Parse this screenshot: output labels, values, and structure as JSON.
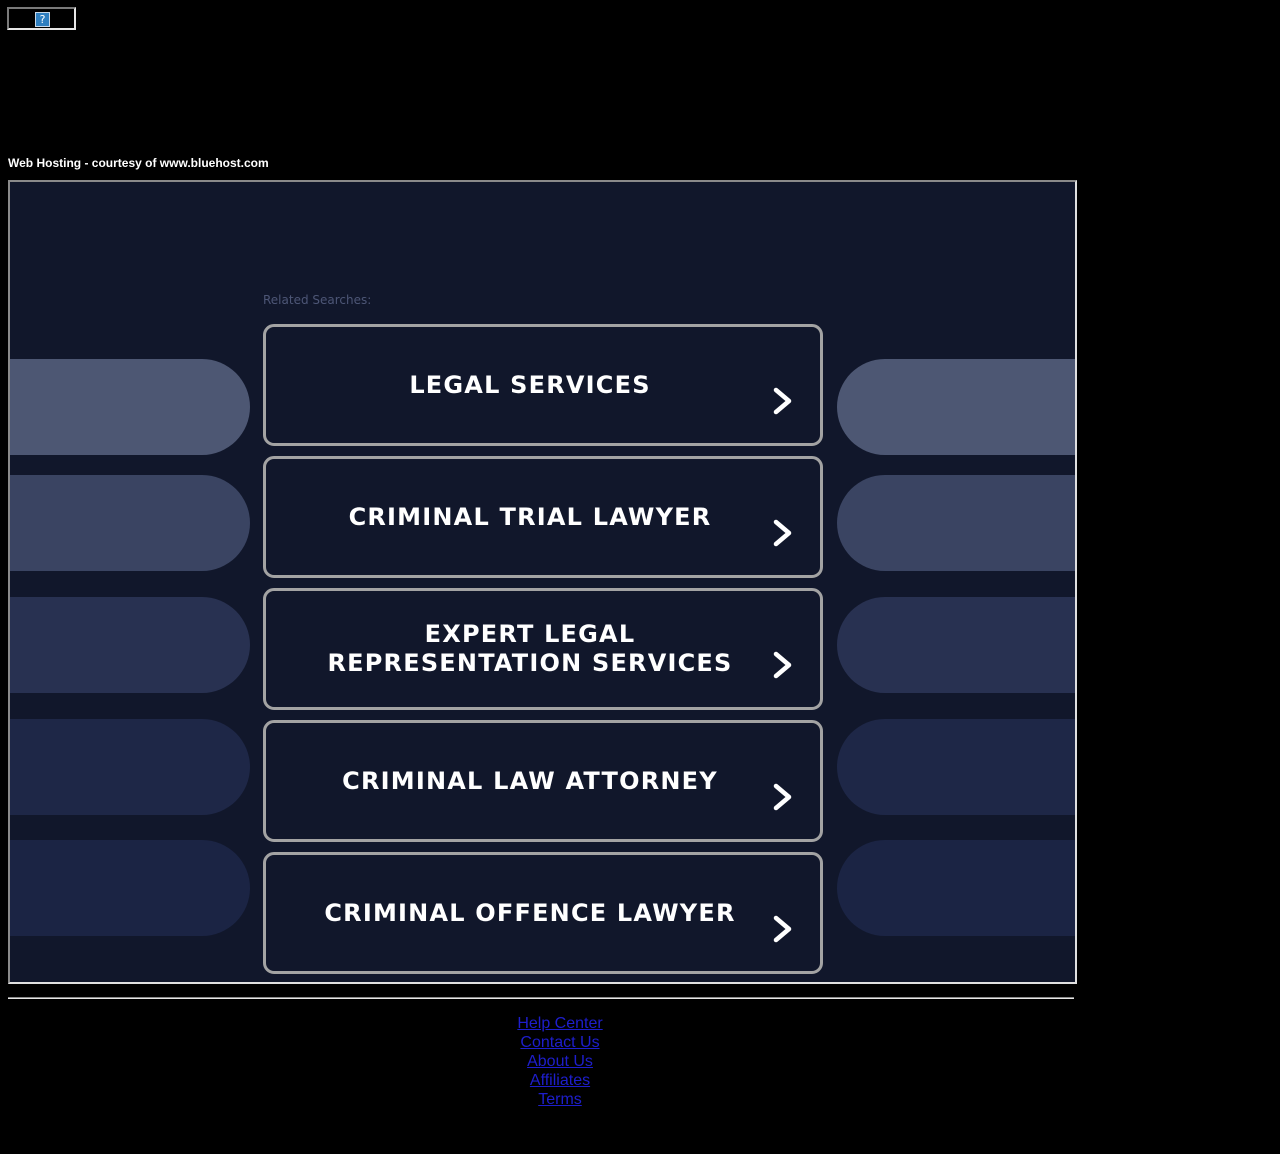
{
  "header": {
    "hosting_note": "Web Hosting - courtesy of www.bluehost.com",
    "broken_image_glyph": "?"
  },
  "main": {
    "related_label": "Related Searches:",
    "searches": [
      {
        "label": "LEGAL SERVICES"
      },
      {
        "label": "CRIMINAL TRIAL LAWYER"
      },
      {
        "label": "EXPERT LEGAL REPRESENTATION SERVICES"
      },
      {
        "label": "CRIMINAL LAW ATTORNEY"
      },
      {
        "label": "CRIMINAL OFFENCE LAWYER"
      }
    ]
  },
  "footer": {
    "links": [
      "Help Center",
      "Contact Us",
      "About Us",
      "Affiliates",
      "Terms"
    ]
  },
  "colors": {
    "page_bg": "#000000",
    "frame_bg": "#11172b",
    "card_border": "#a3a3a3",
    "pill_shades": [
      "#4d5773",
      "#3a4462",
      "#283151",
      "#1e2747",
      "#1b2444"
    ],
    "link": "#1e1ecc"
  }
}
